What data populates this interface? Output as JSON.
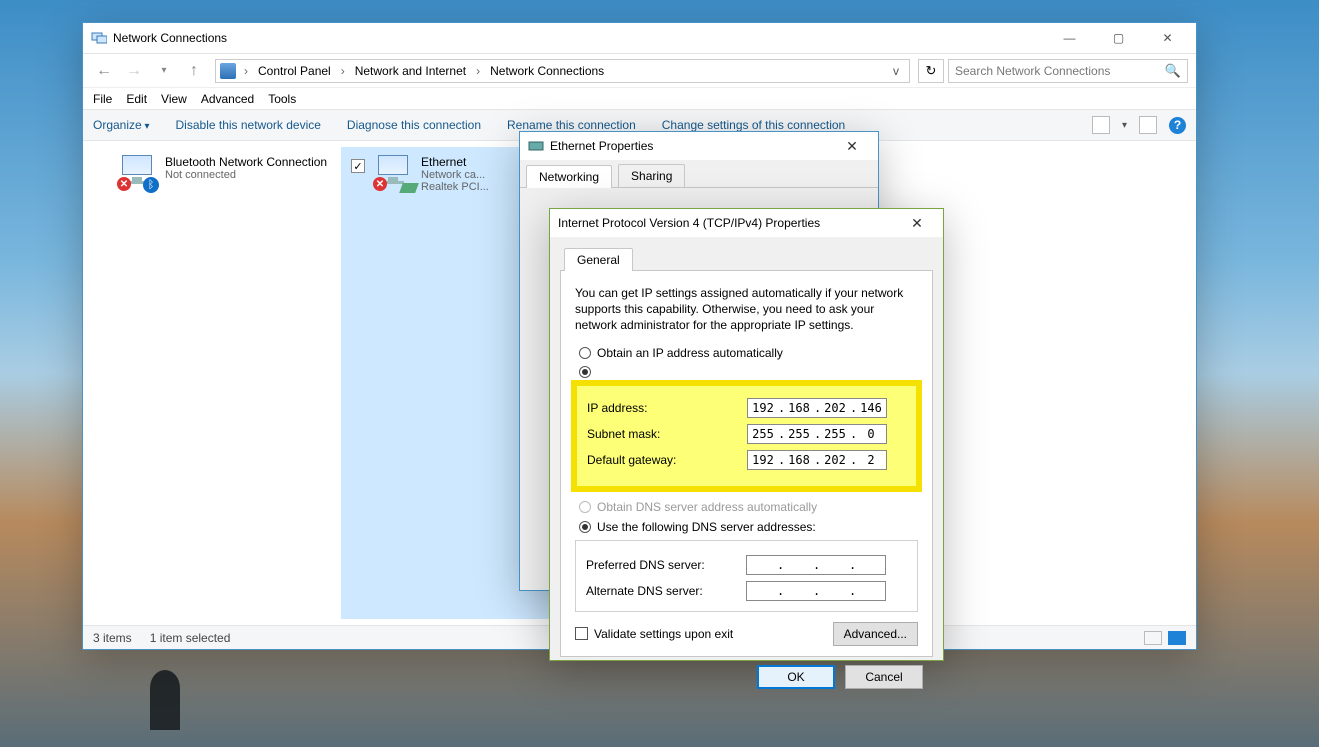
{
  "explorer": {
    "title": "Network Connections",
    "breadcrumbs": [
      "Control Panel",
      "Network and Internet",
      "Network Connections"
    ],
    "search_placeholder": "Search Network Connections",
    "menus": {
      "file": "File",
      "edit": "Edit",
      "view": "View",
      "advanced": "Advanced",
      "tools": "Tools"
    },
    "cmdbar": {
      "organize": "Organize",
      "disable": "Disable this network device",
      "diagnose": "Diagnose this connection",
      "rename": "Rename this connection",
      "change": "Change settings of this connection"
    },
    "connections": [
      {
        "name": "Bluetooth Network Connection",
        "status": "Not connected",
        "driver": ""
      },
      {
        "name": "Ethernet",
        "status": "Network ca...",
        "driver": "Realtek PCI..."
      }
    ],
    "status": {
      "count": "3 items",
      "selected": "1 item selected"
    }
  },
  "eth_dialog": {
    "title": "Ethernet Properties",
    "tabs": {
      "networking": "Networking",
      "sharing": "Sharing"
    }
  },
  "ipv4_dialog": {
    "title": "Internet Protocol Version 4 (TCP/IPv4) Properties",
    "tab_general": "General",
    "description": "You can get IP settings assigned automatically if your network supports this capability. Otherwise, you need to ask your network administrator for the appropriate IP settings.",
    "obtain_ip_auto": "Obtain an IP address automatically",
    "labels": {
      "ip": "IP address:",
      "subnet": "Subnet mask:",
      "gateway": "Default gateway:",
      "pref_dns": "Preferred DNS server:",
      "alt_dns": "Alternate DNS server:"
    },
    "values": {
      "ip": [
        "192",
        "168",
        "202",
        "146"
      ],
      "subnet": [
        "255",
        "255",
        "255",
        "0"
      ],
      "gateway": [
        "192",
        "168",
        "202",
        "2"
      ],
      "pref_dns": [
        "",
        "",
        "",
        ""
      ],
      "alt_dns": [
        "",
        "",
        "",
        ""
      ]
    },
    "obtain_dns_auto": "Obtain DNS server address automatically",
    "use_dns": "Use the following DNS server addresses:",
    "validate": "Validate settings upon exit",
    "advanced": "Advanced...",
    "ok": "OK",
    "cancel": "Cancel"
  }
}
